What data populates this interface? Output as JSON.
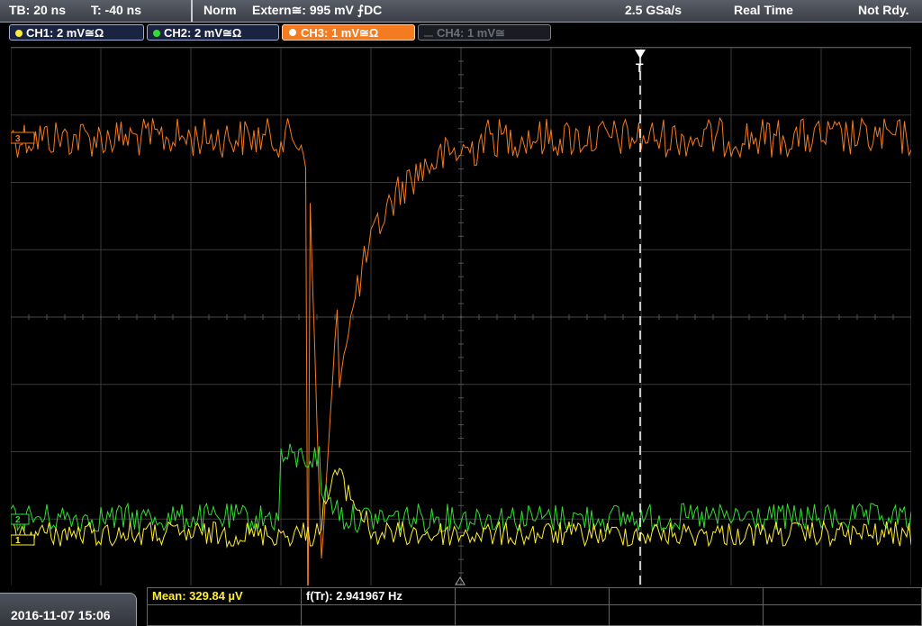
{
  "status_bar": {
    "timebase": "TB: 20 ns",
    "trigger_time": "T: -40 ns",
    "trigger_mode": "Norm",
    "trigger_source": "Extern≅: 995 mV ⨍DC",
    "sample_rate": "2.5 GSa/s",
    "acq_mode": "Real Time",
    "run_state": "Not Rdy."
  },
  "channels": [
    {
      "label": "CH1: 2 mV≅Ω",
      "color": "#ffee33",
      "active": true
    },
    {
      "label": "CH2: 2 mV≅Ω",
      "color": "#33dd33",
      "active": true
    },
    {
      "label": "CH3: 1 mV≅Ω",
      "color": "#f47b20",
      "active": true
    },
    {
      "label": "CH4: 1 mV≅",
      "color": "#6a6e78",
      "active": false
    }
  ],
  "markers": {
    "ch3": "3",
    "ch2": "2",
    "ch1": "1",
    "trigger": "T"
  },
  "measurements": {
    "mean": "Mean: 329.84 µV",
    "freq": "f(Tr): 2.941967 Hz"
  },
  "timestamp": "2016-11-07 15:06",
  "colors": {
    "ch1": "#ffee33",
    "ch2": "#33dd33",
    "ch3": "#f47b20",
    "grid": "#3a3a3a",
    "background": "#000000"
  }
}
